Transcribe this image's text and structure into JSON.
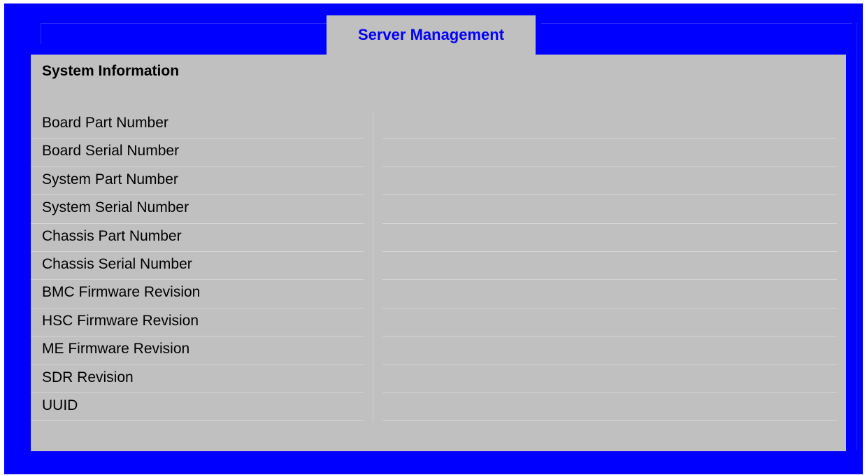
{
  "header": {
    "tab_label": "Server Management"
  },
  "section": {
    "title": "System Information"
  },
  "rows": [
    {
      "label": "Board Part Number",
      "value": ""
    },
    {
      "label": "Board Serial Number",
      "value": ""
    },
    {
      "label": "System Part Number",
      "value": ""
    },
    {
      "label": "System Serial Number",
      "value": ""
    },
    {
      "label": "Chassis Part Number",
      "value": ""
    },
    {
      "label": "Chassis Serial Number",
      "value": ""
    },
    {
      "label": "BMC Firmware Revision",
      "value": ""
    },
    {
      "label": "HSC Firmware Revision",
      "value": ""
    },
    {
      "label": "ME Firmware Revision",
      "value": ""
    },
    {
      "label": "SDR Revision",
      "value": ""
    },
    {
      "label": "UUID",
      "value": ""
    }
  ],
  "colors": {
    "frame": "#0000ff",
    "panel": "#c0c0c0",
    "tab_text": "#0000ff"
  }
}
